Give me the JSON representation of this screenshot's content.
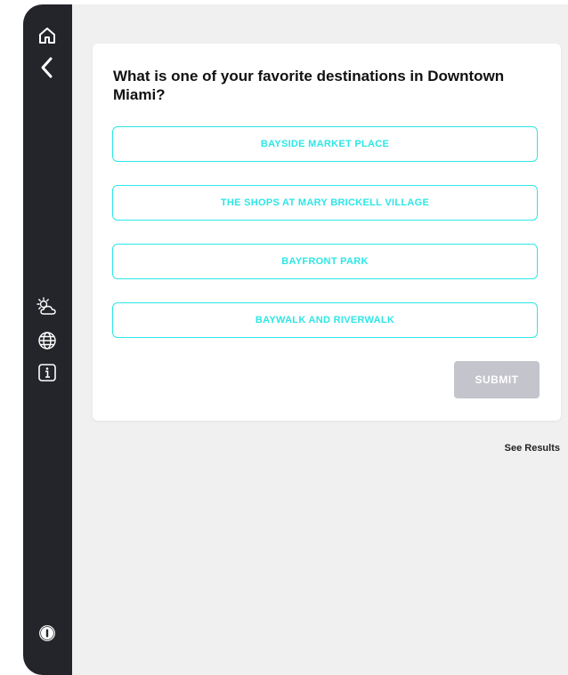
{
  "sidebar": {
    "icons": [
      "home-icon",
      "back-chevron-icon",
      "weather-icon",
      "globe-icon",
      "info-box-icon",
      "info-circle-icon"
    ]
  },
  "poll": {
    "question": "What is one of your favorite destinations in Downtown Miami?",
    "options": [
      "BAYSIDE MARKET PLACE",
      "THE SHOPS AT MARY BRICKELL VILLAGE",
      "BAYFRONT PARK",
      "BAYWALK AND RIVERWALK"
    ],
    "submit_label": "SUBMIT"
  },
  "footer": {
    "see_results": "See Results"
  },
  "colors": {
    "sidebar_bg": "#24252b",
    "page_bg": "#f0f0f0",
    "accent": "#2ee6e6",
    "submit_disabled": "#c4c4cc"
  }
}
